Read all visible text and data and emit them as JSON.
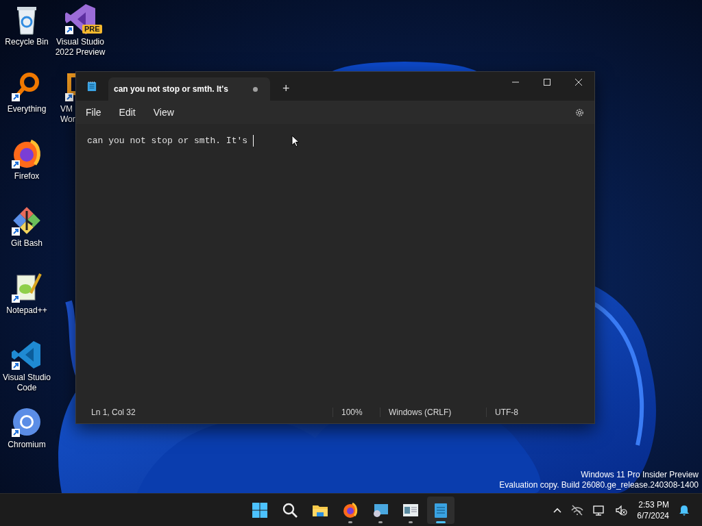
{
  "desktop_icons": [
    {
      "label_lines": [
        "Recycle Bin"
      ],
      "kind": "recycle",
      "shortcut": false
    },
    {
      "label_lines": [
        "Everything"
      ],
      "kind": "everything",
      "shortcut": true
    },
    {
      "label_lines": [
        "Firefox"
      ],
      "kind": "firefox",
      "shortcut": true
    },
    {
      "label_lines": [
        "Git Bash"
      ],
      "kind": "git",
      "shortcut": true
    },
    {
      "label_lines": [
        "Notepad++"
      ],
      "kind": "notepadpp",
      "shortcut": true
    },
    {
      "label_lines": [
        "Visual Studio",
        "Code"
      ],
      "kind": "vscode",
      "shortcut": true
    },
    {
      "label_lines": [
        "Chromium"
      ],
      "kind": "chromium",
      "shortcut": true
    },
    {
      "label_lines": [
        "Visual Studio",
        "2022 Preview"
      ],
      "kind": "vs",
      "shortcut": true,
      "badge": "PRE"
    },
    {
      "label_lines": [
        "VM",
        "Wor"
      ],
      "kind": "vmware",
      "shortcut": true,
      "cut_off": true
    }
  ],
  "window": {
    "tab": {
      "title": "can you not stop or smth. It's",
      "modified": true,
      "selected": true
    },
    "new_tab": "+",
    "menu": [
      "File",
      "Edit",
      "View"
    ],
    "content": "can you not stop or smth. It's ",
    "status_bar": {
      "position": "Ln 1, Col 32",
      "zoom": "100%",
      "line_ending": "Windows (CRLF)",
      "encoding": "UTF-8"
    }
  },
  "watermark_lines": [
    "Windows 11 Pro Insider Preview",
    "Evaluation copy. Build 26080.ge_release.240308-1400"
  ],
  "taskbar": {
    "apps": [
      {
        "kind": "start",
        "running": false,
        "selected": false
      },
      {
        "kind": "search",
        "running": false,
        "selected": false
      },
      {
        "kind": "explorer",
        "running": false,
        "selected": false
      },
      {
        "kind": "firefox",
        "running": true,
        "selected": false
      },
      {
        "kind": "media",
        "running": true,
        "selected": false
      },
      {
        "kind": "viewer",
        "running": true,
        "selected": false
      },
      {
        "kind": "notepad",
        "running": true,
        "selected": true
      }
    ],
    "time": "2:53 PM",
    "date": "6/7/2024"
  }
}
